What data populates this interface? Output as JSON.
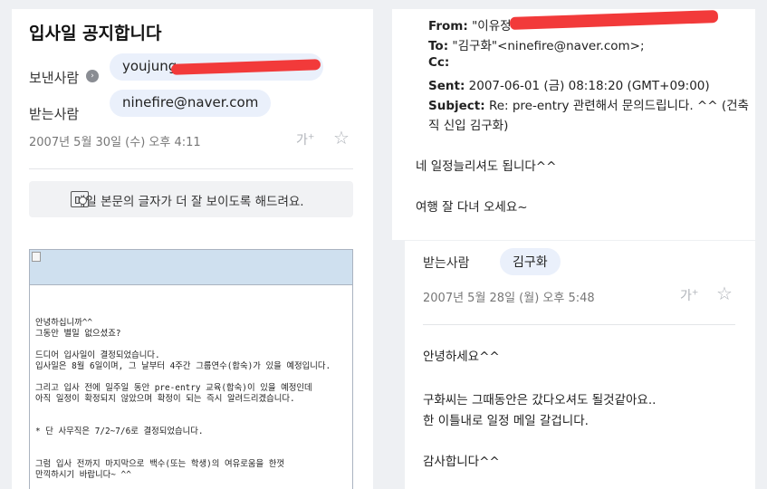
{
  "left": {
    "title": "입사일 공지합니다",
    "sender_label": "보낸사람",
    "sender_value": "youjung",
    "info_glyph": "›",
    "recipient_label": "받는사람",
    "recipient_value": "ninefire@naver.com",
    "date": "2007년 5월 30일 (수) 오후 4:11",
    "font_size_glyph": "가",
    "font_size_plus": "+",
    "star_glyph": "☆",
    "zoom_notice": "메일 본문의 글자가 더 잘 보이도록 해드려요.",
    "letter_lines": [
      "안녕하십니까^^",
      "그동안 별일 없으셨죠?",
      "",
      "드디어 입사일이 결정되었습니다.",
      "입사일은 8월 6일이며, 그 날부터 4주간 그룹연수(합숙)가 있을 예정입니다.",
      "",
      "그리고 입사 전에 일주일 동안 pre-entry 교육(합숙)이 있을 예정인데",
      "아직 일정이 확정되지 않았으며 확정이 되는 즉시 알려드리겠습니다.",
      "",
      "",
      "* 단 사무직은 7/2~7/6로 결정되었습니다.",
      "",
      "",
      "그럼 입사 전까지 마지막으로 백수(또는 학생)의 여유로움을 한껏",
      "만끽하시기 바랍니다~ ^^"
    ]
  },
  "right": {
    "from_label": "From:",
    "from_value": "\"이유정\"",
    "to_label": "To:",
    "to_value": "\"김구화\"<ninefire@naver.com>;",
    "cc_label": "Cc:",
    "sent_label": "Sent:",
    "sent_value": "2007-06-01 (금) 08:18:20 (GMT+09:00)",
    "subject_label": "Subject:",
    "subject_value": "Re: pre-entry 관련해서 문의드립니다. ^^ (건축",
    "subject_value_2": "직 신입 김구화)",
    "reply_line_1": "네 일정늘리셔도 됩니다^^",
    "reply_line_2": "여행 잘 다녀 오세요~"
  },
  "right2": {
    "recipient_label": "받는사람",
    "recipient_value": "김구화",
    "date": "2007년 5월 28일 (월) 오후 5:48",
    "font_size_glyph": "가",
    "font_size_plus": "+",
    "star_glyph": "☆",
    "line_1": "안녕하세요^^",
    "line_2": "구화씨는 그때동안은 갔다오셔도 될것같아요..",
    "line_3": "한 이틀내로 일정 메일 갈겁니다.",
    "line_4": "감사합니다^^"
  },
  "colors": {
    "chip_bg": "#eaf0fb",
    "redaction": "#f23a3a",
    "letter_header": "#cfe0ef"
  }
}
